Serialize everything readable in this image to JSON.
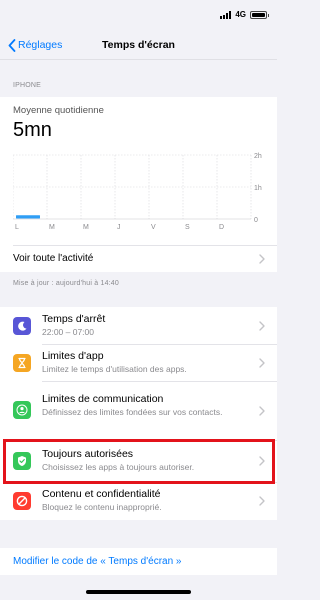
{
  "status": {
    "network": "4G",
    "signal_bars": 4,
    "battery_level": 1.0
  },
  "nav": {
    "back_label": "Réglages",
    "title": "Temps d'écran"
  },
  "device_section": "IPHONE",
  "daily": {
    "label": "Moyenne quotidienne",
    "value": "5mn"
  },
  "chart_data": {
    "type": "bar",
    "categories": [
      "L",
      "M",
      "M",
      "J",
      "V",
      "S",
      "D"
    ],
    "values": [
      0.1,
      0,
      0,
      0,
      0,
      0,
      0
    ],
    "y_tick_labels": [
      "2h",
      "1h",
      "0"
    ],
    "ylim": [
      0,
      2
    ],
    "bar_color": "#2f9ef5",
    "grid": true
  },
  "activity_link": "Voir toute l'activité",
  "updated": "Mise à jour : aujourd'hui à 14:40",
  "settings": [
    {
      "title": "Temps d'arrêt",
      "subtitle": "22:00 – 07:00",
      "icon": "moon-icon",
      "color": "#5856d6"
    },
    {
      "title": "Limites d'app",
      "subtitle": "Limitez le temps d'utilisation des apps.",
      "icon": "hourglass-icon",
      "color": "#f5a623"
    },
    {
      "title": "Limites de communication",
      "subtitle": "Définissez des limites fondées sur vos contacts.",
      "icon": "person-icon",
      "color": "#34c759"
    },
    {
      "title": "Toujours autorisées",
      "subtitle": "Choisissez les apps à toujours autoriser.",
      "icon": "checkmark-icon",
      "color": "#34c759"
    },
    {
      "title": "Contenu et confidentialité",
      "subtitle": "Bloquez le contenu inapproprié.",
      "icon": "prohibited-icon",
      "color": "#ff3b30"
    }
  ],
  "change_code_link": "Modifier le code de « Temps d'écran »"
}
